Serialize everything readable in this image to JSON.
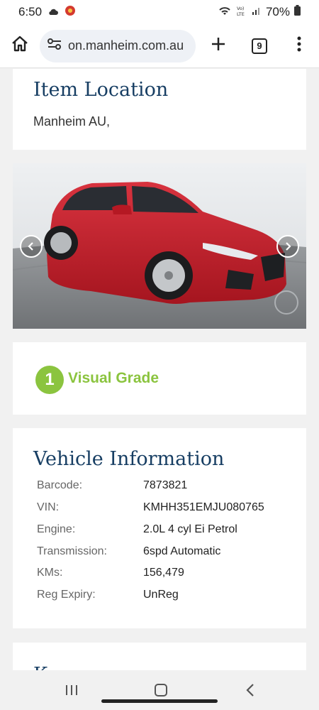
{
  "status_bar": {
    "time": "6:50",
    "battery": "70%",
    "icons": [
      "cloud-icon",
      "app-notification-icon",
      "wifi-icon",
      "volte-icon",
      "signal-icon",
      "battery-icon"
    ],
    "volte_label": "Vo) LTE"
  },
  "browser": {
    "url": "on.manheim.com.au",
    "tab_count": "9",
    "icons": [
      "home-icon",
      "site-settings-icon",
      "plus-icon",
      "tabs-icon",
      "more-vert-icon"
    ]
  },
  "location": {
    "title": "Item Location",
    "text": "Manheim AU,"
  },
  "gallery": {
    "icons": [
      "chevron-left-icon",
      "chevron-right-icon"
    ],
    "car_color": "#c8202e"
  },
  "grade": {
    "number": "1",
    "label": "Visual Grade",
    "color": "#8bc43f"
  },
  "vehicle": {
    "title": "Vehicle Information",
    "specs": [
      {
        "label": "Barcode:",
        "value": "7873821"
      },
      {
        "label": "VIN:",
        "value": "KMHH351EMJU080765"
      },
      {
        "label": "Engine:",
        "value": "2.0L 4 cyl Ei Petrol"
      },
      {
        "label": "Transmission:",
        "value": "6spd Automatic"
      },
      {
        "label": "KMs:",
        "value": "156,479"
      },
      {
        "label": "Reg Expiry:",
        "value": "UnReg"
      }
    ]
  },
  "next_section": {
    "title": "Keys"
  },
  "colors": {
    "heading": "#173e63",
    "background": "#f1f1f1"
  }
}
